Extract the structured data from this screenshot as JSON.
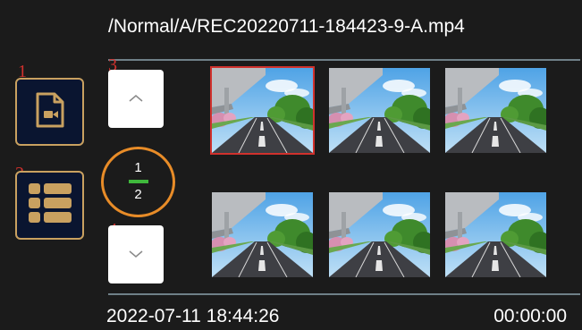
{
  "header": {
    "file_path": "/Normal/A/REC20220711-184423-9-A.mp4"
  },
  "callouts": [
    "1",
    "2",
    "3",
    "4"
  ],
  "sidebar": [
    {
      "name": "video-file",
      "icon": "video-file-icon"
    },
    {
      "name": "thumbnail-view",
      "icon": "grid-list-icon"
    }
  ],
  "pager": {
    "up_icon": "chevron-up-icon",
    "down_icon": "chevron-down-icon",
    "current": "1",
    "total": "2"
  },
  "thumbnails": [
    {
      "selected": true
    },
    {
      "selected": false
    },
    {
      "selected": false
    },
    {
      "selected": false
    },
    {
      "selected": false
    },
    {
      "selected": false
    }
  ],
  "status": {
    "date_time": "2022-07-11 18:44:26",
    "duration": "00:00:00"
  },
  "colors": {
    "background": "#1b1b1b",
    "accent_gold": "#c9a160",
    "button_navy": "#0a1530",
    "callout_red": "#d0312d",
    "indicator_orange": "#e88c28",
    "indicator_green": "#3fb83c",
    "divider": "#6f8088"
  }
}
